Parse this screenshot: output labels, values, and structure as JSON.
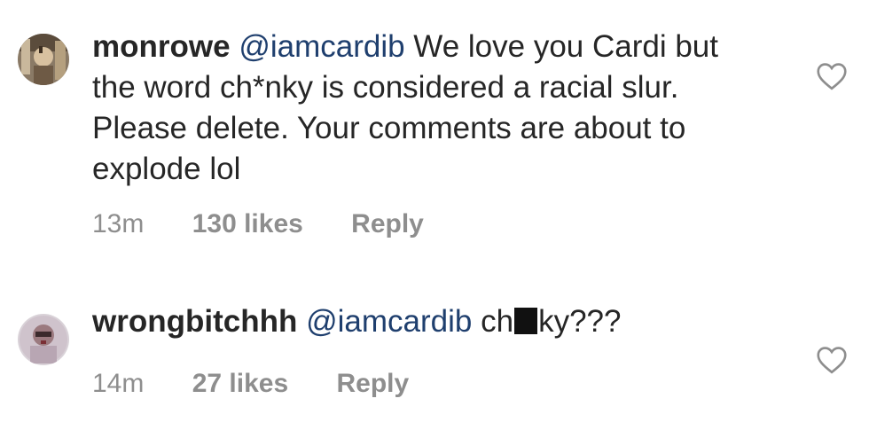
{
  "comments": [
    {
      "username": "monrowe",
      "mention": "@iamcardib",
      "text": " We love you Cardi but the word ch*nky is considered a racial slur. Please delete. Your comments are about to explode lol",
      "time": "13m",
      "likes": "130 likes",
      "reply_label": "Reply",
      "icons": {
        "avatar": "user-avatar-photo",
        "like": "heart-outline-icon"
      }
    },
    {
      "username": "wrongbitchhh",
      "mention": "@iamcardib",
      "text_before": " ch",
      "text_after": "ky???",
      "time": "14m",
      "likes": "27 likes",
      "reply_label": "Reply",
      "icons": {
        "avatar": "user-avatar-photo",
        "like": "heart-outline-icon"
      }
    }
  ],
  "colors": {
    "username": "#262626",
    "mention": "#1f3f6e",
    "meta": "#8e8e8e"
  }
}
